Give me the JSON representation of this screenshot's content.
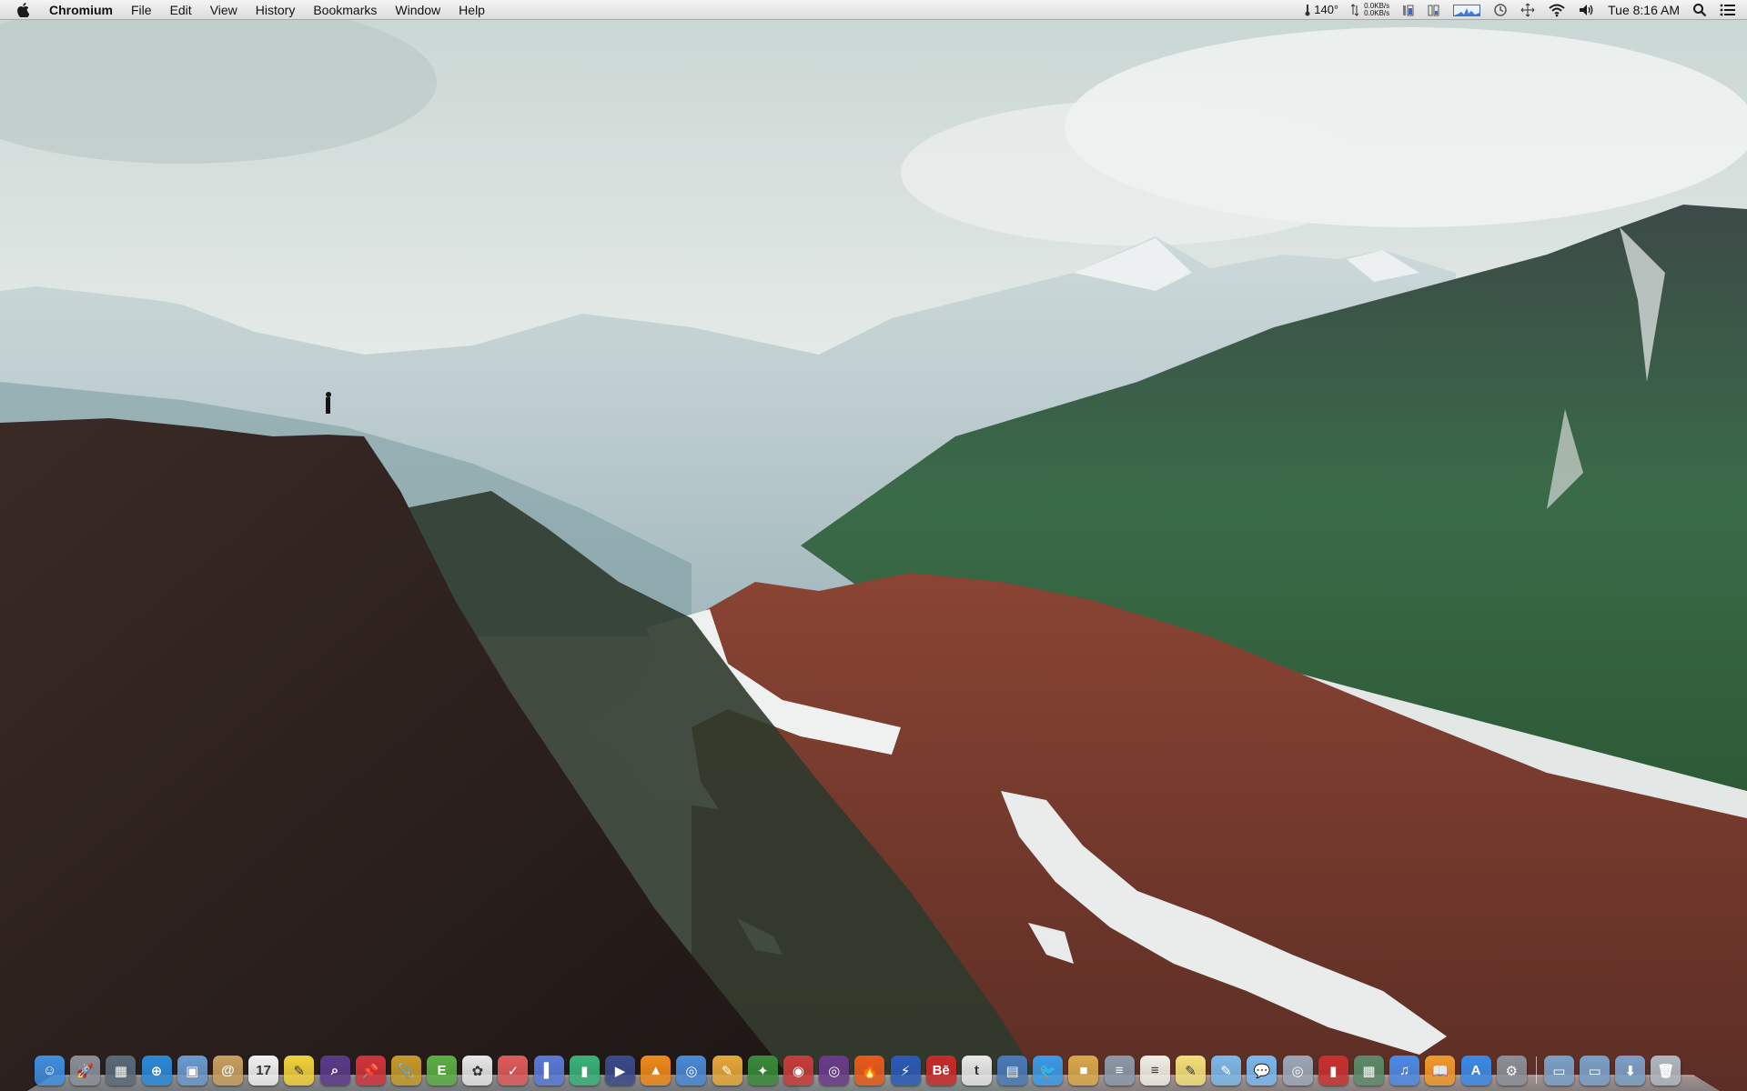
{
  "menubar": {
    "app_name": "Chromium",
    "menus": [
      "File",
      "Edit",
      "View",
      "History",
      "Bookmarks",
      "Window",
      "Help"
    ],
    "status": {
      "temperature": "140°",
      "net_up": "0.0KB/s",
      "net_down": "0.0KB/s",
      "clock": "Tue 8:16 AM"
    }
  },
  "dock": {
    "apps": [
      {
        "icon": "finder-icon",
        "color": "#3f8fe0",
        "glyph": "☺"
      },
      {
        "icon": "launchpad-icon",
        "color": "#8a8f98",
        "glyph": "🚀"
      },
      {
        "icon": "mission-control-icon",
        "color": "#5a6a7a",
        "glyph": "▦"
      },
      {
        "icon": "safari-icon",
        "color": "#2a8ad8",
        "glyph": "⊕"
      },
      {
        "icon": "preview-icon",
        "color": "#6a9ad0",
        "glyph": "▣"
      },
      {
        "icon": "contacts-icon",
        "color": "#c8a060",
        "glyph": "@"
      },
      {
        "icon": "calendar-icon",
        "color": "#f3f3f3",
        "glyph": "17"
      },
      {
        "icon": "stickies-icon",
        "color": "#f2d23a",
        "glyph": "✎"
      },
      {
        "icon": "alfred-icon",
        "color": "#5a3a8a",
        "glyph": "⌕"
      },
      {
        "icon": "pin-icon",
        "color": "#d0343a",
        "glyph": "📌"
      },
      {
        "icon": "clip-icon",
        "color": "#c89a2a",
        "glyph": "📎"
      },
      {
        "icon": "evernote-icon",
        "color": "#5bb043",
        "glyph": "E"
      },
      {
        "icon": "colors-icon",
        "color": "#e8e8e8",
        "glyph": "✿"
      },
      {
        "icon": "wunderlist-icon",
        "color": "#e05b5b",
        "glyph": "✓"
      },
      {
        "icon": "books-icon",
        "color": "#5a7ad8",
        "glyph": "▌"
      },
      {
        "icon": "marker-icon",
        "color": "#39b37a",
        "glyph": "▮"
      },
      {
        "icon": "quicktime-icon",
        "color": "#3a4a8a",
        "glyph": "▶"
      },
      {
        "icon": "vlc-icon",
        "color": "#f08a1a",
        "glyph": "▲"
      },
      {
        "icon": "chrome-icon",
        "color": "#4a8ad8",
        "glyph": "◎"
      },
      {
        "icon": "sketch-icon",
        "color": "#e8a83a",
        "glyph": "✎"
      },
      {
        "icon": "photos-icon",
        "color": "#3a8a3a",
        "glyph": "✦"
      },
      {
        "icon": "photo-booth-icon",
        "color": "#c83a3a",
        "glyph": "◉"
      },
      {
        "icon": "camera-icon",
        "color": "#6a3a8a",
        "glyph": "◎"
      },
      {
        "icon": "firefox-icon",
        "color": "#e85a1a",
        "glyph": "🔥"
      },
      {
        "icon": "reeder-icon",
        "color": "#2a5ab8",
        "glyph": "⚡"
      },
      {
        "icon": "behance-icon",
        "color": "#c82a2a",
        "glyph": "Bē"
      },
      {
        "icon": "typewriter-icon",
        "color": "#e8e8e8",
        "glyph": "t"
      },
      {
        "icon": "sheets-icon",
        "color": "#4a7ab8",
        "glyph": "▤"
      },
      {
        "icon": "twitter-icon",
        "color": "#3a9ae8",
        "glyph": "🐦"
      },
      {
        "icon": "package-icon",
        "color": "#d8a84a",
        "glyph": "■"
      },
      {
        "icon": "textedit-icon",
        "color": "#8a9aaa",
        "glyph": "≡"
      },
      {
        "icon": "notes-icon",
        "color": "#f0f0e8",
        "glyph": "≡"
      },
      {
        "icon": "notepad-icon",
        "color": "#f2e07a",
        "glyph": "✎"
      },
      {
        "icon": "maps-icon",
        "color": "#7ab8e8",
        "glyph": "✎"
      },
      {
        "icon": "messages-icon",
        "color": "#7ab8f0",
        "glyph": "💬"
      },
      {
        "icon": "screenshot-icon",
        "color": "#9aa8b8",
        "glyph": "◎"
      },
      {
        "icon": "photo-slideshow-icon",
        "color": "#c83030",
        "glyph": "▮"
      },
      {
        "icon": "image-capture-icon",
        "color": "#5a8a6a",
        "glyph": "▦"
      },
      {
        "icon": "itunes-icon",
        "color": "#4a8ae8",
        "glyph": "♫"
      },
      {
        "icon": "ibooks-icon",
        "color": "#f09a2a",
        "glyph": "📖"
      },
      {
        "icon": "app-store-icon",
        "color": "#3a8ae8",
        "glyph": "A"
      },
      {
        "icon": "system-preferences-icon",
        "color": "#8a8f98",
        "glyph": "⚙"
      }
    ],
    "stacks": [
      {
        "icon": "applications-folder-icon",
        "color": "#7aa0c8",
        "glyph": "▭"
      },
      {
        "icon": "documents-folder-icon",
        "color": "#7aa0c8",
        "glyph": "▭"
      },
      {
        "icon": "downloads-folder-icon",
        "color": "#7aa0c8",
        "glyph": "⬇"
      },
      {
        "icon": "trash-icon",
        "color": "#b0b8c0",
        "glyph": "🗑"
      }
    ]
  }
}
